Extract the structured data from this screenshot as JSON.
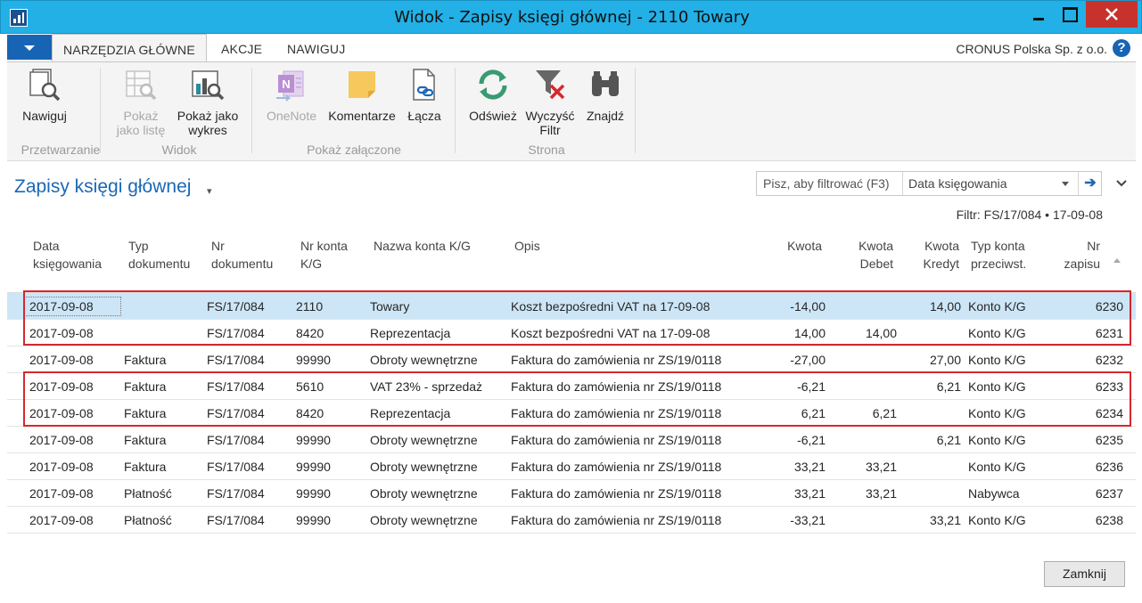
{
  "window": {
    "title": "Widok - Zapisy księgi głównej - 2110 Towary"
  },
  "ribbon_tabs": [
    {
      "label": "NARZĘDZIA GŁÓWNE",
      "active": true
    },
    {
      "label": "AKCJE",
      "active": false
    },
    {
      "label": "NAWIGUJ",
      "active": false
    }
  ],
  "company": "CRONUS Polska Sp. z o.o.",
  "help_label": "?",
  "ribbon": {
    "buttons": {
      "nawiguj": "Nawiguj",
      "pokaz_liste_1": "Pokaż",
      "pokaz_liste_2": "jako listę",
      "pokaz_wykres_1": "Pokaż jako",
      "pokaz_wykres_2": "wykres",
      "onenote": "OneNote",
      "komentarze": "Komentarze",
      "lacza": "Łącza",
      "odswiez": "Odśwież",
      "wyczysc_1": "Wyczyść",
      "wyczysc_2": "Filtr",
      "znajdz": "Znajdź"
    },
    "groups": {
      "przetwarzanie": "Przetwarzanie",
      "widok": "Widok",
      "pokaz_zalaczone": "Pokaż załączone",
      "strona": "Strona"
    }
  },
  "page": {
    "title": "Zapisy księgi głównej",
    "filter_placeholder": "Pisz, aby filtrować (F3)",
    "filter_field": "Data księgowania",
    "filter_summary": "Filtr: FS/17/084 • 17-09-08"
  },
  "columns": {
    "data_1": "Data",
    "data_2": "księgowania",
    "typ_1": "Typ",
    "typ_2": "dokumentu",
    "nrdok_1": "Nr",
    "nrdok_2": "dokumentu",
    "nrkonta_1": "Nr konta",
    "nrkonta_2": "K/G",
    "nazwa": "Nazwa konta K/G",
    "opis": "Opis",
    "kwota": "Kwota",
    "debet_1": "Kwota",
    "debet_2": "Debet",
    "kredyt_1": "Kwota",
    "kredyt_2": "Kredyt",
    "typkonta_1": "Typ konta",
    "typkonta_2": "przeciwst.",
    "nrzap_1": "Nr",
    "nrzap_2": "zapisu"
  },
  "rows": [
    {
      "data": "2017-09-08",
      "typ": "",
      "nrdok": "FS/17/084",
      "nrkonta": "2110",
      "nazwa": "Towary",
      "opis": "Koszt bezpośredni VAT na 17-09-08",
      "kwota": "-14,00",
      "debet": "",
      "kredyt": "14,00",
      "typkonta": "Konto K/G",
      "nrzap": "6230"
    },
    {
      "data": "2017-09-08",
      "typ": "",
      "nrdok": "FS/17/084",
      "nrkonta": "8420",
      "nazwa": "Reprezentacja",
      "opis": "Koszt bezpośredni VAT na 17-09-08",
      "kwota": "14,00",
      "debet": "14,00",
      "kredyt": "",
      "typkonta": "Konto K/G",
      "nrzap": "6231"
    },
    {
      "data": "2017-09-08",
      "typ": "Faktura",
      "nrdok": "FS/17/084",
      "nrkonta": "99990",
      "nazwa": "Obroty wewnętrzne",
      "opis": "Faktura do zamówienia nr ZS/19/0118",
      "kwota": "-27,00",
      "debet": "",
      "kredyt": "27,00",
      "typkonta": "Konto K/G",
      "nrzap": "6232"
    },
    {
      "data": "2017-09-08",
      "typ": "Faktura",
      "nrdok": "FS/17/084",
      "nrkonta": "5610",
      "nazwa": "VAT 23% - sprzedaż",
      "opis": "Faktura do zamówienia nr ZS/19/0118",
      "kwota": "-6,21",
      "debet": "",
      "kredyt": "6,21",
      "typkonta": "Konto K/G",
      "nrzap": "6233"
    },
    {
      "data": "2017-09-08",
      "typ": "Faktura",
      "nrdok": "FS/17/084",
      "nrkonta": "8420",
      "nazwa": "Reprezentacja",
      "opis": "Faktura do zamówienia nr ZS/19/0118",
      "kwota": "6,21",
      "debet": "6,21",
      "kredyt": "",
      "typkonta": "Konto K/G",
      "nrzap": "6234"
    },
    {
      "data": "2017-09-08",
      "typ": "Faktura",
      "nrdok": "FS/17/084",
      "nrkonta": "99990",
      "nazwa": "Obroty wewnętrzne",
      "opis": "Faktura do zamówienia nr ZS/19/0118",
      "kwota": "-6,21",
      "debet": "",
      "kredyt": "6,21",
      "typkonta": "Konto K/G",
      "nrzap": "6235"
    },
    {
      "data": "2017-09-08",
      "typ": "Faktura",
      "nrdok": "FS/17/084",
      "nrkonta": "99990",
      "nazwa": "Obroty wewnętrzne",
      "opis": "Faktura do zamówienia nr ZS/19/0118",
      "kwota": "33,21",
      "debet": "33,21",
      "kredyt": "",
      "typkonta": "Konto K/G",
      "nrzap": "6236"
    },
    {
      "data": "2017-09-08",
      "typ": "Płatność",
      "nrdok": "FS/17/084",
      "nrkonta": "99990",
      "nazwa": "Obroty wewnętrzne",
      "opis": "Faktura do zamówienia nr ZS/19/0118",
      "kwota": "33,21",
      "debet": "33,21",
      "kredyt": "",
      "typkonta": "Nabywca",
      "nrzap": "6237"
    },
    {
      "data": "2017-09-08",
      "typ": "Płatność",
      "nrdok": "FS/17/084",
      "nrkonta": "99990",
      "nazwa": "Obroty wewnętrzne",
      "opis": "Faktura do zamówienia nr ZS/19/0118",
      "kwota": "-33,21",
      "debet": "",
      "kredyt": "33,21",
      "typkonta": "Konto K/G",
      "nrzap": "6238"
    }
  ],
  "close_button": "Zamknij",
  "colors": {
    "titlebar": "#22b0e6",
    "accent": "#1b68b6",
    "selected_row": "#cde6f7",
    "highlight_box": "#d6272e"
  }
}
